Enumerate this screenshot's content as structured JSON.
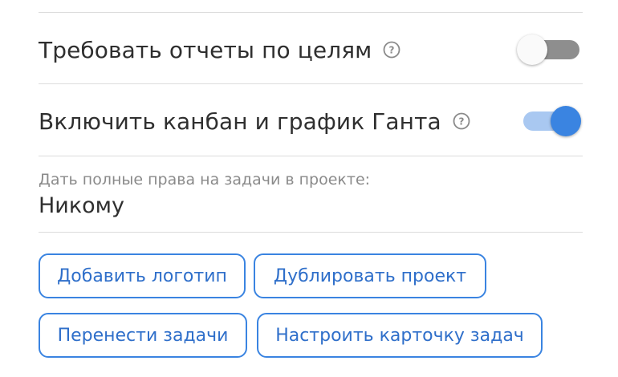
{
  "settings": [
    {
      "label": "Требовать отчеты по целям",
      "help_icon": "question-circle-icon",
      "toggle_on": false
    },
    {
      "label": "Включить канбан и график Ганта",
      "help_icon": "question-circle-icon",
      "toggle_on": true
    }
  ],
  "full_rights": {
    "label": "Дать полные права на задачи в проекте:",
    "value": "Никому"
  },
  "buttons": {
    "add_logo": "Добавить логотип",
    "duplicate_project": "Дублировать проект",
    "move_tasks": "Перенести задачи",
    "configure_task_card": "Настроить карточку задач"
  },
  "colors": {
    "accent": "#3a84e1",
    "accent_light": "#a9c8f1",
    "toggle_off_track": "#8e8e8e",
    "divider": "#dcdcdc",
    "text": "#2f2f2f",
    "muted_text": "#8a8a8a"
  }
}
